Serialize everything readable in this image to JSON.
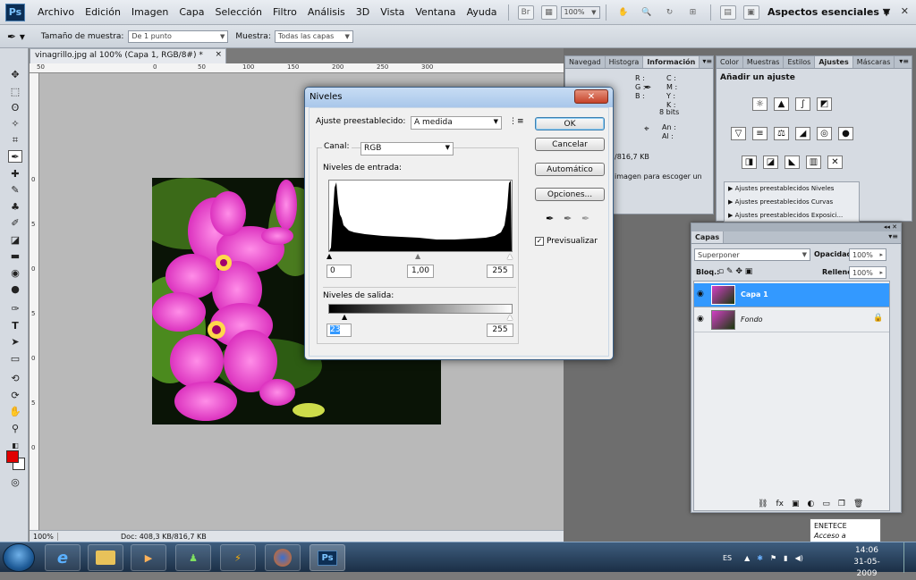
{
  "app": {
    "logo": "Ps",
    "workspace": "Aspectos esenciales",
    "zoom_field": "100%"
  },
  "menu": [
    "Archivo",
    "Edición",
    "Imagen",
    "Capa",
    "Selección",
    "Filtro",
    "Análisis",
    "3D",
    "Vista",
    "Ventana",
    "Ayuda"
  ],
  "window_buttons": {
    "minimize": "–",
    "restore": "▫",
    "close": "✕"
  },
  "options_bar": {
    "sample_size_label": "Tamaño de muestra:",
    "sample_size_value": "De 1 punto",
    "sample_label": "Muestra:",
    "sample_value": "Todas las capas"
  },
  "document": {
    "tab_title": "vinagrillo.jpg al 100% (Capa 1, RGB/8#) *",
    "close": "×",
    "zoom": "100%",
    "doc_info": "Doc: 408,3 KB/816,7 KB",
    "ruler_top": [
      "50",
      "0",
      "50",
      "100",
      "150",
      "200",
      "250",
      "300"
    ],
    "ruler_left": [
      "0",
      "5",
      "0",
      "5",
      "0",
      "5",
      "0"
    ]
  },
  "info_panel": {
    "tabs": [
      "Navegad",
      "Histogra",
      "Información"
    ],
    "active_tab": "Información",
    "left": [
      "R :",
      "G :",
      "B :"
    ],
    "right": [
      "C :",
      "M :",
      "Y :",
      "K :"
    ],
    "bits": "8 bits",
    "an": "An :",
    "al": "Al :",
    "file_size": "/816,7 KB",
    "hint": "imagen para escoger un"
  },
  "adjustments_panel": {
    "tabs": [
      "Color",
      "Muestras",
      "Estilos",
      "Ajustes",
      "Máscaras"
    ],
    "active_tab": "Ajustes",
    "title": "Añadir un ajuste",
    "presets": [
      "Ajustes preestablecidos Niveles",
      "Ajustes preestablecidos Curvas",
      "Ajustes preestablecidos Exposici..."
    ]
  },
  "layers_panel": {
    "tab": "Capas",
    "blend_mode": "Superponer",
    "opacity_label": "Opacidad:",
    "opacity_value": "100%",
    "lock_label": "Bloq.:",
    "fill_label": "Relleno:",
    "fill_value": "100%",
    "layers": [
      {
        "name": "Capa 1",
        "selected": true
      },
      {
        "name": "Fondo",
        "selected": false
      }
    ],
    "footer_icons": [
      "link-icon",
      "fx-icon",
      "mask-icon",
      "adjustment-icon",
      "group-icon",
      "new-layer-icon",
      "trash-icon"
    ]
  },
  "levels_dialog": {
    "title": "Niveles",
    "close": "✕",
    "preset_label": "Ajuste preestablecido:",
    "preset_value": "A medida",
    "channel_label": "Canal:",
    "channel_value": "RGB",
    "input_label": "Niveles de entrada:",
    "input_black": "0",
    "input_gamma": "1,00",
    "input_white": "255",
    "output_label": "Niveles de salida:",
    "output_black": "23",
    "output_white": "255",
    "buttons": {
      "ok": "OK",
      "cancel": "Cancelar",
      "auto": "Automático",
      "options": "Opciones..."
    },
    "preview_label": "Previsualizar",
    "preview_checked": true
  },
  "taskbar": {
    "lang": "ES",
    "time": "14:06",
    "date": "31-05-2009",
    "tooltip_title": "ENETECE",
    "tooltip_text": "Acceso a Internet",
    "ps_label": "Ps"
  },
  "colors": {
    "foreground": "#e00000",
    "background": "#ffffff",
    "selection": "#3399ff",
    "flower": "#e83fd0"
  }
}
